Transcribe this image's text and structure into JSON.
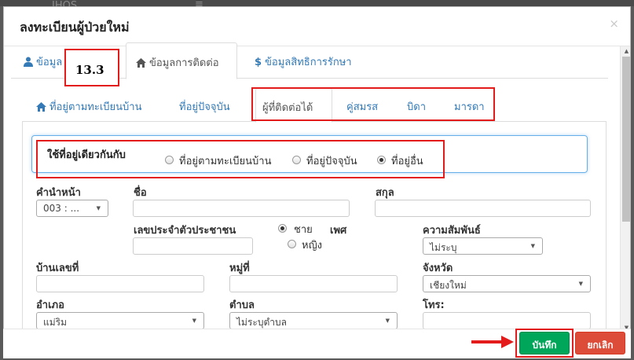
{
  "modal": {
    "title": "ลงทะเบียนผู้ป่วยใหม่",
    "close": "×"
  },
  "background": {
    "logo_text": "JHOS",
    "menu_icon": "≡"
  },
  "main_tabs": [
    {
      "label": "ข้อมูล",
      "icon": "user-icon"
    },
    {
      "label": "ข้อมูลการติดต่อ",
      "icon": "home-icon",
      "active": true
    },
    {
      "label": "ข้อมูลสิทธิการรักษา",
      "icon": "dollar-icon"
    }
  ],
  "annotation": {
    "step": "13.3",
    "accent": "#e31b1b"
  },
  "sub_tabs": [
    {
      "label": "ที่อยู่ตามทะเบียนบ้าน",
      "icon": "home-icon"
    },
    {
      "label": "ที่อยู่ปัจจุบัน"
    },
    {
      "label": "ผู้ที่ติดต่อได้",
      "active": true
    },
    {
      "label": "คู่สมรส"
    },
    {
      "label": "บิดา"
    },
    {
      "label": "มารดา"
    }
  ],
  "address_option": {
    "label": "ใช้ที่อยู่เดียวกันกับ",
    "options": [
      "ที่อยู่ตามทะเบียนบ้าน",
      "ที่อยู่ปัจจุบัน",
      "ที่อยู่อื่น"
    ],
    "selected": "ที่อยู่อื่น"
  },
  "form": {
    "prefix": {
      "label": "คำนำหน้า",
      "value": "003 : ..."
    },
    "first_name": {
      "label": "ชื่อ",
      "value": ""
    },
    "last_name": {
      "label": "สกุล",
      "value": ""
    },
    "citizen_id": {
      "label": "เลขประจำตัวประชาชน",
      "value": ""
    },
    "gender": {
      "label": "เพศ",
      "options": [
        "ชาย",
        "หญิง"
      ],
      "selected": "ชาย"
    },
    "relationship": {
      "label": "ความสัมพันธ์",
      "value": "ไม่ระบุ"
    },
    "house_no": {
      "label": "บ้านเลขที่",
      "value": ""
    },
    "village_no": {
      "label": "หมู่ที่",
      "value": ""
    },
    "province": {
      "label": "จังหวัด",
      "value": "เชียงใหม่"
    },
    "district": {
      "label": "อำเภอ",
      "value": "แม่ริม"
    },
    "subdistrict": {
      "label": "ตำบล",
      "value": "ไม่ระบุตำบล"
    },
    "phone": {
      "label": "โทร:",
      "value": ""
    }
  },
  "footer": {
    "save_label": "บันทึก",
    "cancel_label": "ยกเลิก",
    "save_color": "#00a65a",
    "cancel_color": "#dd4b39"
  }
}
